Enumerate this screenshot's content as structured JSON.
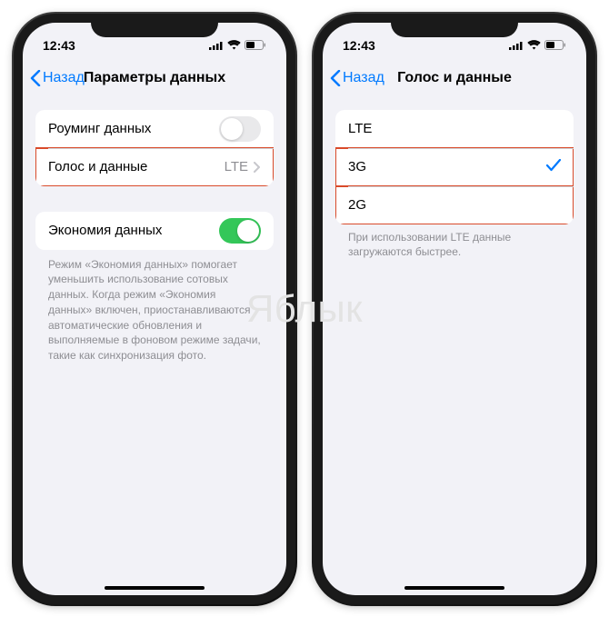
{
  "watermark": "Яблык",
  "status": {
    "time": "12:43"
  },
  "left": {
    "back": "Назад",
    "title": "Параметры данных",
    "roaming_label": "Роуминг данных",
    "voice_data_label": "Голос и данные",
    "voice_data_value": "LTE",
    "low_data_label": "Экономия данных",
    "low_data_footer": "Режим «Экономия данных» помогает уменьшить использование сотовых данных. Когда режим «Экономия данных» включен, приостанавливаются автоматические обновления и выполняемые в фоновом режиме задачи, такие как синхронизация фото."
  },
  "right": {
    "back": "Назад",
    "title": "Голос и данные",
    "opt_lte": "LTE",
    "opt_3g": "3G",
    "opt_2g": "2G",
    "selected": "3G",
    "footer": "При использовании LTE данные загружаются быстрее."
  }
}
